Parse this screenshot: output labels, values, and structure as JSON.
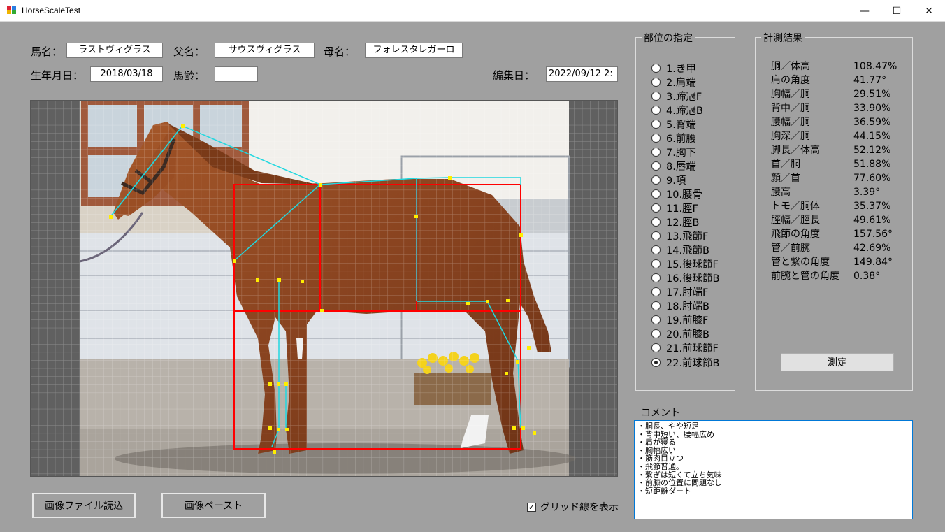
{
  "window": {
    "title": "HorseScaleTest",
    "controls": {
      "minimize": "—",
      "maximize": "☐",
      "close": "✕"
    }
  },
  "form": {
    "horse_name_label": "馬名：",
    "horse_name": "ラストヴィグラス",
    "sire_label": "父名：",
    "sire": "サウスヴィグラス",
    "dam_label": "母名：",
    "dam": "フォレスタレガーロ",
    "birthdate_label": "生年月日：",
    "birthdate": "2018/03/18",
    "age_label": "馬齢：",
    "age": "",
    "edit_date_label": "編集日：",
    "edit_date": "2022/09/12 2:"
  },
  "buttons": {
    "load_image": "画像ファイル読込",
    "paste_image": "画像ペースト",
    "measure": "測定"
  },
  "grid_checkbox": {
    "label": "グリッド線を表示",
    "checked": true,
    "mark": "✓"
  },
  "part_selection": {
    "title": "部位の指定",
    "selected_index": 21,
    "items": [
      "1.き甲",
      "2.肩端",
      "3.蹄冠F",
      "4.蹄冠B",
      "5.臀端",
      "6.前腰",
      "7.胸下",
      "8.唇端",
      "9.項",
      "10.腰骨",
      "11.脛F",
      "12.脛B",
      "13.飛節F",
      "14.飛節B",
      "15.後球節F",
      "16.後球節B",
      "17.肘端F",
      "18.肘端B",
      "19.前膝F",
      "20.前膝B",
      "21.前球節F",
      "22.前球節B"
    ]
  },
  "results": {
    "title": "計測結果",
    "rows": [
      {
        "name": "胴／体高",
        "value": "108.47%"
      },
      {
        "name": "肩の角度",
        "value": "41.77°"
      },
      {
        "name": "胸幅／胴",
        "value": "29.51%"
      },
      {
        "name": "背中／胴",
        "value": "33.90%"
      },
      {
        "name": "腰幅／胴",
        "value": "36.59%"
      },
      {
        "name": "胸深／胴",
        "value": "44.15%"
      },
      {
        "name": "脚長／体高",
        "value": "52.12%"
      },
      {
        "name": "首／胴",
        "value": "51.88%"
      },
      {
        "name": "顔／首",
        "value": "77.60%"
      },
      {
        "name": "腰高",
        "value": "3.39°"
      },
      {
        "name": "トモ／胴体",
        "value": "35.37%"
      },
      {
        "name": "脛幅／脛長",
        "value": "49.61%"
      },
      {
        "name": "飛節の角度",
        "value": "157.56°"
      },
      {
        "name": "管／前腕",
        "value": "42.69%"
      },
      {
        "name": "管と繋の角度",
        "value": "149.84°"
      },
      {
        "name": "前腕と管の角度",
        "value": "0.38°"
      }
    ]
  },
  "comment": {
    "label": "コメント",
    "lines": [
      "・胴長、やや短足",
      "・背中短い、腰幅広め",
      "・肩が寝る",
      "・胸幅広い",
      "・筋肉目立つ",
      "・飛節普通。",
      "・繋ぎは短くて立ち気味",
      "・前膝の位置に問題なし",
      "・短距離ダート"
    ]
  },
  "colors": {
    "form_bg": "#a0a0a0",
    "measure_box": "#ff0000",
    "measure_line": "#20d8e0",
    "measure_point": "#ffee00",
    "horse_coat": "#8a4420"
  }
}
